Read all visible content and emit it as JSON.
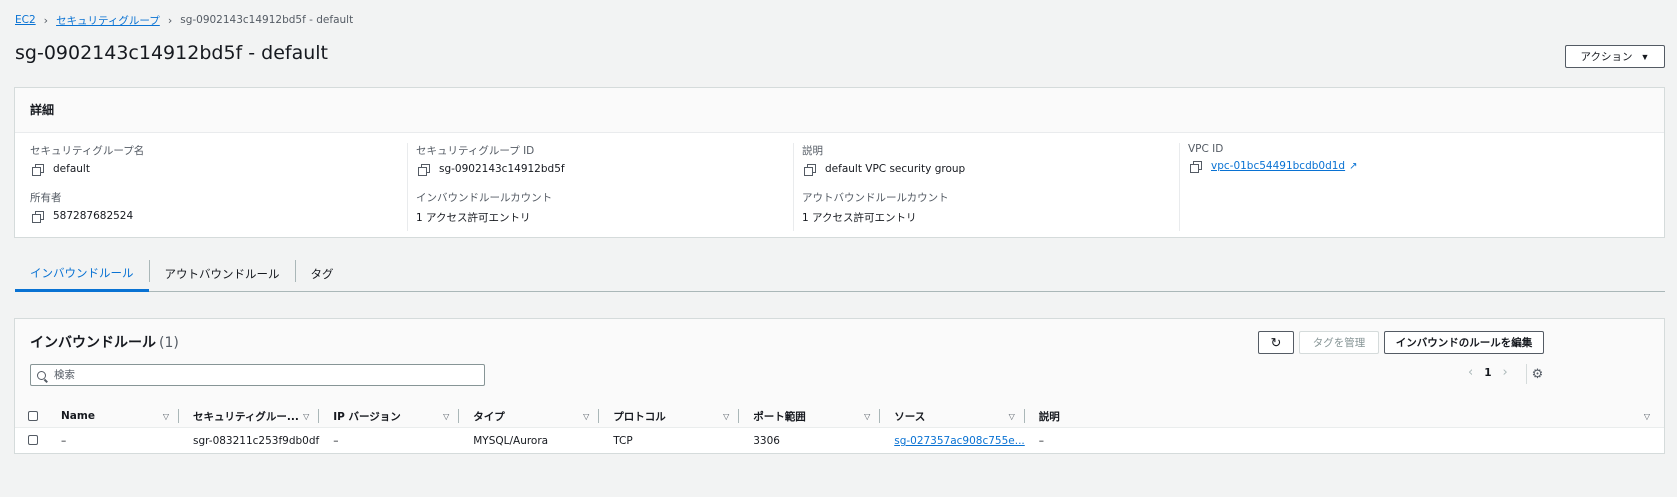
{
  "breadcrumb": {
    "items": [
      "EC2",
      "セキュリティグループ"
    ],
    "current": "sg-0902143c14912bd5f - default"
  },
  "page_title": "sg-0902143c14912bd5f - default",
  "actions_label": "アクション",
  "details": {
    "header": "詳細",
    "fields": {
      "sg_name": {
        "label": "セキュリティグループ名",
        "value": "default"
      },
      "sg_id": {
        "label": "セキュリティグループ ID",
        "value": "sg-0902143c14912bd5f"
      },
      "description": {
        "label": "説明",
        "value": "default VPC security group"
      },
      "vpc_id": {
        "label": "VPC ID",
        "value": "vpc-01bc54491bcdb0d1d"
      },
      "owner": {
        "label": "所有者",
        "value": "587287682524"
      },
      "inbound_count": {
        "label": "インバウンドルールカウント",
        "value": "1 アクセス許可エントリ"
      },
      "outbound_count": {
        "label": "アウトバウンドルールカウント",
        "value": "1 アクセス許可エントリ"
      }
    }
  },
  "tabs": [
    "インバウンドルール",
    "アウトバウンドルール",
    "タグ"
  ],
  "rules": {
    "title": "インバウンドルール",
    "count": "(1)",
    "manage_tags_label": "タグを管理",
    "edit_label": "インバウンドのルールを編集",
    "search_placeholder": "検索",
    "page": "1",
    "columns": [
      "Name",
      "セキュリティグルー...",
      "IP バージョン",
      "タイプ",
      "プロトコル",
      "ポート範囲",
      "ソース",
      "説明"
    ],
    "rows": [
      {
        "name": "–",
        "rule_id": "sgr-083211c253f9db0df",
        "ip_version": "–",
        "type": "MYSQL/Aurora",
        "protocol": "TCP",
        "port": "3306",
        "source": "sg-027357ac908c755e...",
        "description": "–"
      }
    ]
  },
  "colors": {
    "link": "#0972d3",
    "background": "#f2f3f3",
    "panel": "#ffffff",
    "border": "#d5dbdb"
  }
}
